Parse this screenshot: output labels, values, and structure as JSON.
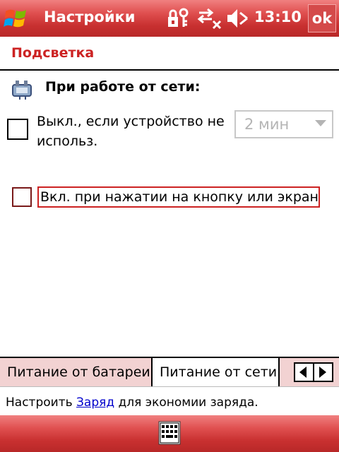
{
  "titlebar": {
    "title": "Настройки",
    "time": "13:10",
    "ok_label": "ok",
    "icons": [
      "windows-start-icon",
      "lock-key-icon",
      "connectivity-icon",
      "volume-muted-icon"
    ]
  },
  "page": {
    "header": "Подсветка",
    "section_label": "При работе от сети:",
    "section_icon": "power-plug-icon"
  },
  "options": {
    "auto_off_label": "Выкл., если устройство не использ.",
    "auto_off_checked": false,
    "timeout_value": "2 мин",
    "turn_on_label": "Вкл. при нажатии на кнопку или экран",
    "turn_on_checked": false
  },
  "tabs": {
    "battery_label": "Питание от батареи",
    "network_label": "Питание от сети",
    "active": "Питание от сети"
  },
  "footer": {
    "prefix": "Настроить",
    "link": "Заряд",
    "suffix": "для экономии заряда."
  },
  "menubar": {
    "keyboard_icon": "keyboard-icon"
  },
  "colors": {
    "accent": "#cc2222",
    "bar": "#d84040",
    "tab_inactive": "#f2d2d2",
    "link": "#0000cc"
  }
}
